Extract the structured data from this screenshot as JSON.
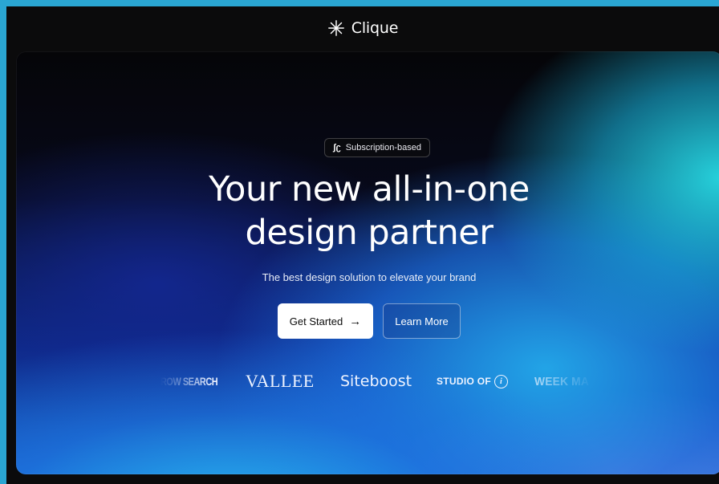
{
  "nav": {
    "brand_icon": "asterisk-burst-icon",
    "brand_name": "Clique"
  },
  "hero": {
    "badge": {
      "icon": "refresh-icon",
      "icon_glyph": "ʃʗ",
      "label": "Subscription-based"
    },
    "headline_line1": "Your new all-in-one",
    "headline_line2": "design partner",
    "subtitle": "The best design solution to elevate your brand",
    "primary_button": {
      "label": "Get Started",
      "icon": "arrow-right-icon",
      "icon_glyph": "→"
    },
    "secondary_button": {
      "label": "Learn More"
    },
    "logos": [
      "ROW SEARCH",
      "VALLEE",
      "Siteboost",
      "STUDIO OF",
      "WEEK MA"
    ],
    "logo_studio_mark": "i"
  },
  "colors": {
    "page_border": "#2aa6d3",
    "background": "#0b0b0c",
    "accent_cyan": "#28dce6",
    "accent_blue": "#1a63d0",
    "button_primary_bg": "#ffffff",
    "text_primary": "#ffffff"
  }
}
